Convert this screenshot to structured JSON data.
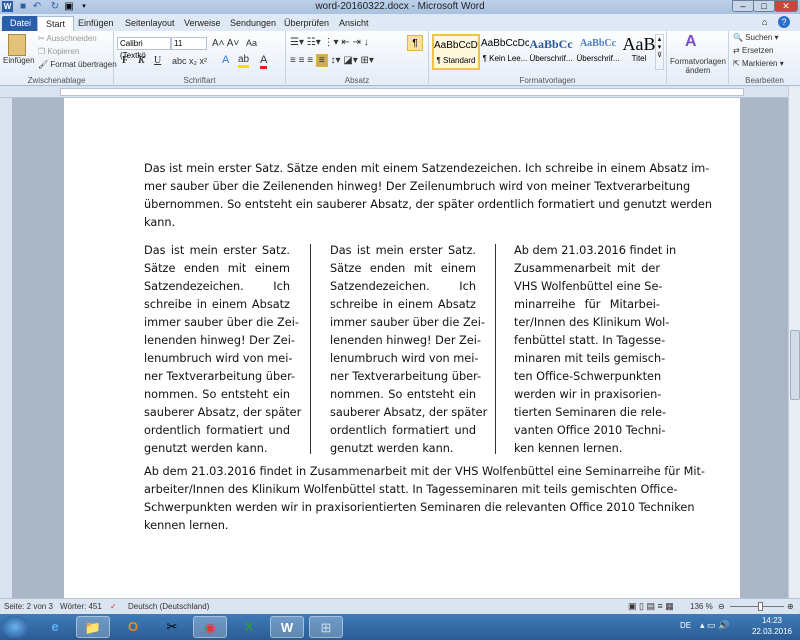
{
  "window": {
    "title": "word-20160322.docx - Microsoft Word"
  },
  "tabs": [
    "Datei",
    "Start",
    "Einfügen",
    "Seitenlayout",
    "Verweise",
    "Sendungen",
    "Überprüfen",
    "Ansicht"
  ],
  "ribbon": {
    "clipboard": {
      "paste": "Einfügen",
      "cut": "Ausschneiden",
      "copy": "Kopieren",
      "format_painter": "Format übertragen",
      "label": "Zwischenablage"
    },
    "font": {
      "name": "Calibri (Textkö",
      "size": "11",
      "label": "Schriftart",
      "bold": "F",
      "italic": "K",
      "underline": "U",
      "case": "Aa"
    },
    "paragraph": {
      "label": "Absatz",
      "pilcrow": "¶"
    },
    "styles": {
      "label": "Formatvorlagen",
      "items": [
        {
          "preview": "AaBbCcDc",
          "name": "¶ Standard"
        },
        {
          "preview": "AaBbCcDc",
          "name": "¶ Kein Lee..."
        },
        {
          "preview": "AaBbCc",
          "name": "Überschrif..."
        },
        {
          "preview": "AaBbCc",
          "name": "Überschrif..."
        },
        {
          "preview": "AaB",
          "name": "Titel"
        }
      ],
      "change": "Formatvorlagen ändern"
    },
    "editing": {
      "label": "Bearbeiten",
      "find": "Suchen",
      "replace": "Ersetzen",
      "select": "Markieren"
    }
  },
  "document": {
    "para1": [
      "Das ist mein erster Satz. Sätze enden mit einem Satzendezeichen. Ich schreibe in einem Absatz im-",
      "mer sauber über die Zeilenenden hinweg! Der Zeilenumbruch wird von meiner Textverarbeitung",
      "übernommen. So entsteht ein sauberer Absatz, der später ordentlich formatiert und genutzt werden",
      "kann."
    ],
    "col1": [
      "Das ist mein erster Satz.",
      "Sätze enden mit einem",
      "Satzendezeichen. Ich",
      "schreibe in einem Absatz",
      "immer sauber über die Zei-",
      "lenenden hinweg! Der Zei-",
      "lenumbruch wird von mei-",
      "ner Textverarbeitung über-",
      "nommen. So entsteht ein",
      "sauberer Absatz, der später",
      "ordentlich formatiert und",
      "genutzt werden kann."
    ],
    "col2": [
      "Das ist mein erster Satz.",
      "Sätze enden mit einem",
      "Satzendezeichen. Ich",
      "schreibe in einem Absatz",
      "immer sauber über die Zei-",
      "lenenden hinweg! Der Zei-",
      "lenumbruch wird von mei-",
      "ner Textverarbeitung über-",
      "nommen. So entsteht ein",
      "sauberer Absatz, der später",
      "ordentlich formatiert und",
      "genutzt werden kann."
    ],
    "col3": [
      "Ab dem 21.03.2016 findet in",
      "Zusammenarbeit mit der",
      "VHS Wolfenbüttel eine Se-",
      "minarreihe für Mitarbei-",
      "ter/Innen des Klinikum Wol-",
      "fenbüttel statt. In Tagesse-",
      "minaren mit teils gemisch-",
      "ten Office-Schwerpunkten",
      "werden wir in praxisorien-",
      "tierten Seminaren die rele-",
      "vanten Office 2010 Techni-",
      "ken kennen lernen."
    ],
    "para2": [
      "Ab dem 21.03.2016 findet in Zusammenarbeit mit der VHS Wolfenbüttel eine Seminarreihe für Mit-",
      "arbeiter/Innen des Klinikum Wolfenbüttel statt. In Tagesseminaren mit teils gemischten Office-",
      "Schwerpunkten werden wir in praxisorientierten Seminaren die relevanten  Office 2010 Techniken",
      "kennen lernen."
    ]
  },
  "status": {
    "page": "Seite: 2 von 3",
    "words": "Wörter: 451",
    "language": "Deutsch (Deutschland)",
    "zoom": "136 %"
  },
  "taskbar": {
    "lang": "DE",
    "time": "14:23",
    "date": "22.03.2016"
  }
}
